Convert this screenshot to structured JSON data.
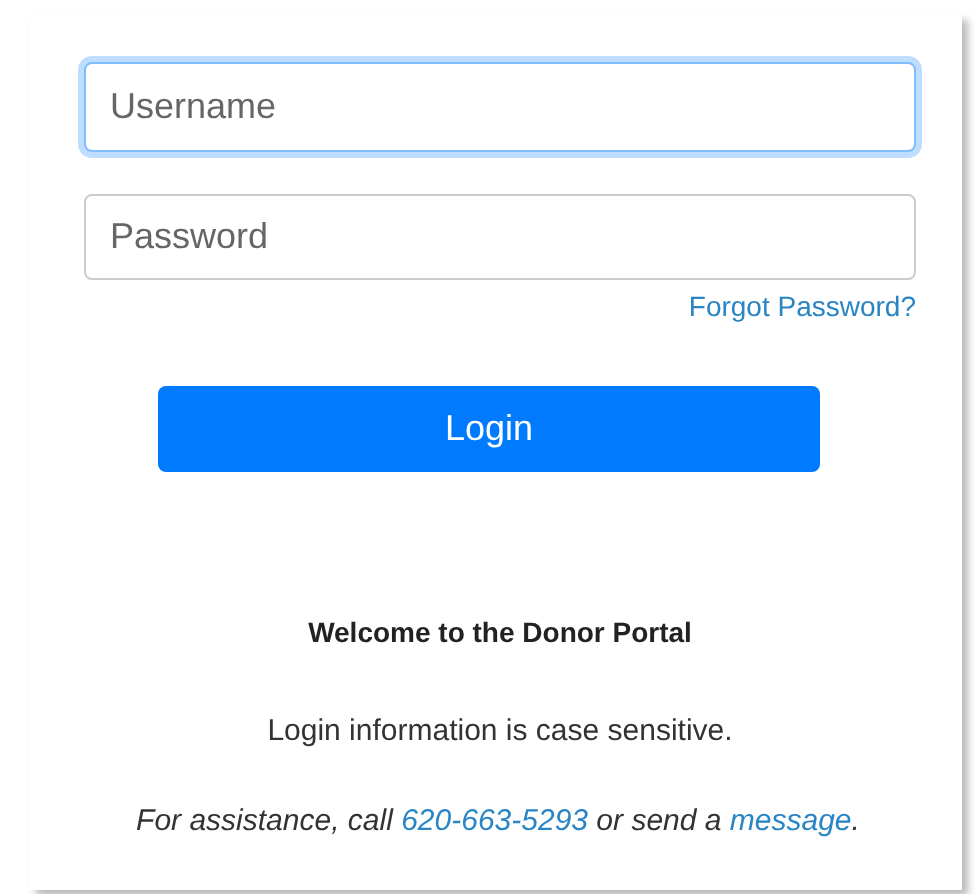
{
  "username": {
    "placeholder": "Username",
    "focused": true
  },
  "password": {
    "placeholder": "Password",
    "focused": false
  },
  "forgot_link": "Forgot Password?",
  "login_button": "Login",
  "welcome": "Welcome to the Donor Portal",
  "info": "Login information is case sensitive.",
  "assistance": [
    {
      "kind": "text",
      "text": "For assistance, call "
    },
    {
      "kind": "link",
      "text": "620-663-5293"
    },
    {
      "kind": "text",
      "text": " or send a "
    },
    {
      "kind": "link",
      "text": "message"
    },
    {
      "kind": "text",
      "text": "."
    }
  ]
}
